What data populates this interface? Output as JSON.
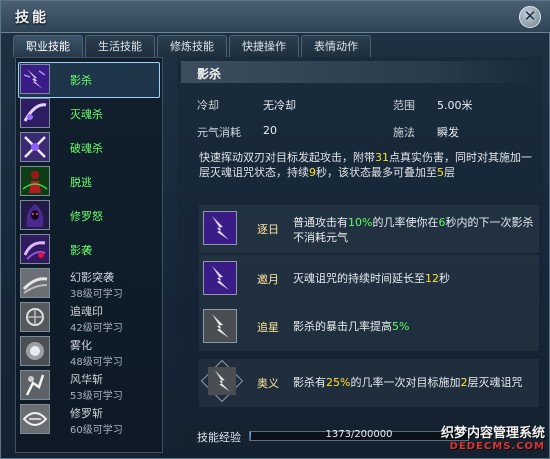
{
  "window": {
    "title": "技能",
    "close_glyph": "✕"
  },
  "tabs": [
    {
      "label": "职业技能",
      "active": true
    },
    {
      "label": "生活技能",
      "active": false
    },
    {
      "label": "修炼技能",
      "active": false
    },
    {
      "label": "快捷操作",
      "active": false
    },
    {
      "label": "表情动作",
      "active": false
    }
  ],
  "skills": [
    {
      "name": "影杀",
      "learned": true,
      "selected": true,
      "icon": "purple-lightning-icon"
    },
    {
      "name": "灭魂杀",
      "learned": true,
      "icon": "purple-slash-icon"
    },
    {
      "name": "破魂杀",
      "learned": true,
      "icon": "purple-cross-slash-icon"
    },
    {
      "name": "脱逃",
      "learned": true,
      "icon": "red-figure-icon"
    },
    {
      "name": "修罗怒",
      "learned": true,
      "icon": "hooded-figure-icon"
    },
    {
      "name": "影袭",
      "learned": true,
      "icon": "purple-swirl-icon"
    },
    {
      "name": "幻影突袭",
      "learned": false,
      "requirement": "38级可学习",
      "icon": "phantom-dash-icon"
    },
    {
      "name": "追魂印",
      "learned": false,
      "requirement": "42级可学习",
      "icon": "soul-mark-icon"
    },
    {
      "name": "雾化",
      "learned": false,
      "requirement": "48级可学习",
      "icon": "mist-orb-icon"
    },
    {
      "name": "风华斩",
      "learned": false,
      "requirement": "53级可学习",
      "icon": "wind-slash-icon"
    },
    {
      "name": "修罗斩",
      "learned": false,
      "requirement": "60级可学习",
      "icon": "asura-slash-icon"
    }
  ],
  "detail": {
    "title": "影杀",
    "cooldown_label": "冷却",
    "cooldown_value": "无冷却",
    "range_label": "范围",
    "range_value": "5.00米",
    "cost_label": "元气消耗",
    "cost_value": "20",
    "cast_label": "施法",
    "cast_value": "瞬发",
    "desc_parts": [
      "快速挥动双刃对目标发起攻击，附带",
      "31",
      "点真实伤害，同时对其施加一层灭魂诅咒状态，持续",
      "9",
      "秒，该状态最多可叠加至",
      "5",
      "层"
    ]
  },
  "upgrades": [
    {
      "name": "逐日",
      "icon": "purple-lightning-icon",
      "parts": [
        "普通攻击有",
        "10%",
        "的几率使你在",
        "6",
        "秒内的下一次影杀不消耗元气"
      ]
    },
    {
      "name": "邀月",
      "icon": "purple-lightning-icon",
      "parts": [
        "灭魂诅咒的持续时间延长至",
        "12",
        "秒"
      ]
    },
    {
      "name": "追星",
      "icon": "gray-lightning-icon",
      "parts": [
        "影杀的暴击几率提高",
        "5%",
        ""
      ]
    },
    {
      "name": "奥义",
      "icon": "gray-lightning-icon",
      "parts": [
        "影杀有",
        "25%",
        "的几率一次对目标施加",
        "2",
        "层灭魂诅咒"
      ]
    }
  ],
  "experience": {
    "label": "技能经验",
    "text": "1373/200000",
    "current": 1373,
    "max": 200000
  },
  "watermark": {
    "line1": "织梦内容管理系统",
    "line2": "DEDECMS.COM"
  },
  "colors": {
    "learned": "#6bff6b",
    "highlight": "#ffe22a",
    "highlight_green": "#60ff60",
    "selected_frame": "#9fd1ff"
  }
}
